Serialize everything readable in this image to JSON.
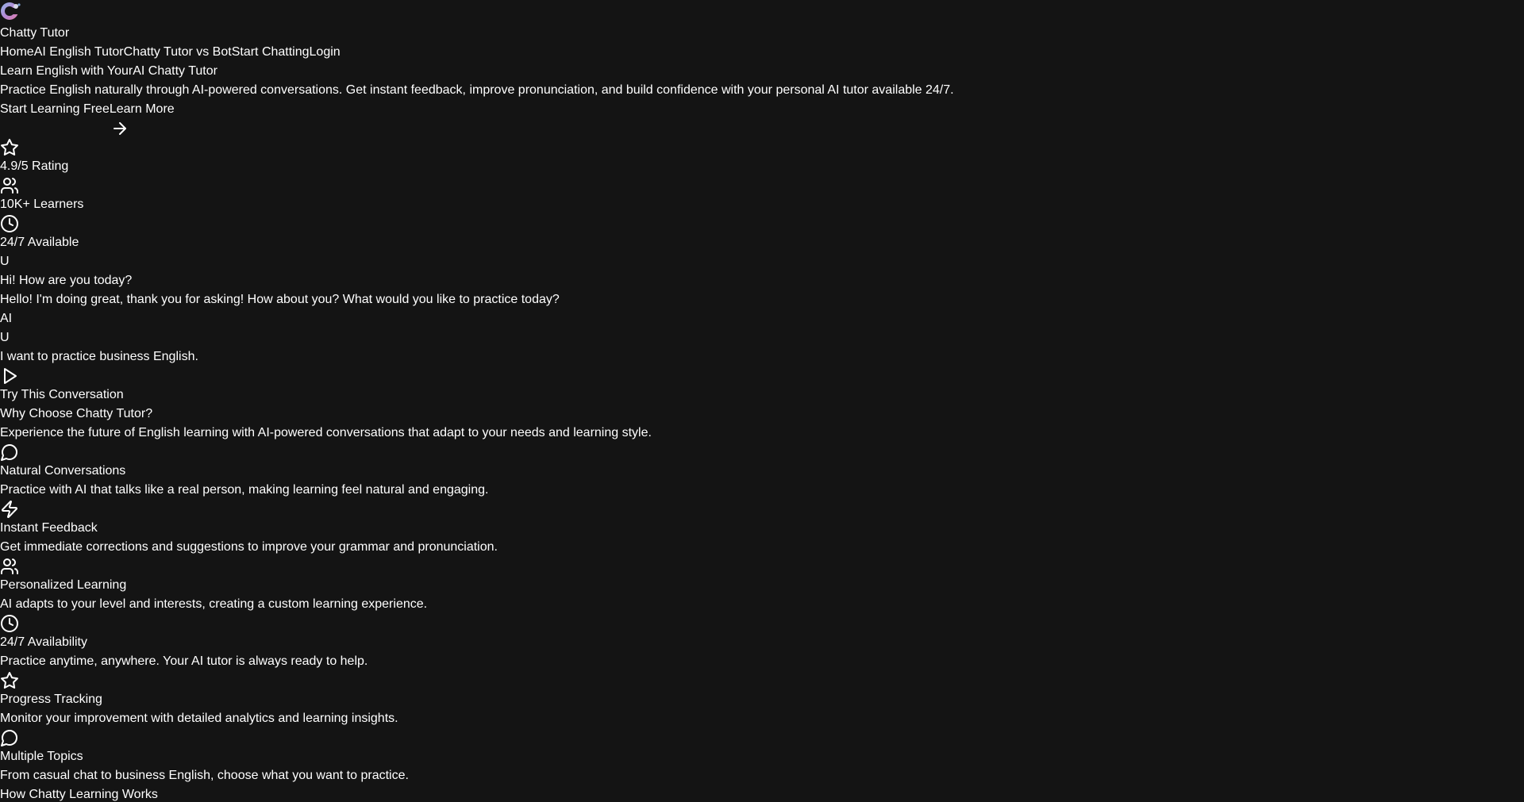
{
  "brand": {
    "name": "Chatty Tutor",
    "logo_icon": "chatty-tutor-logo-icon"
  },
  "nav": {
    "items": [
      "Home",
      "AI English Tutor",
      "Chatty Tutor vs Bot",
      "Start Chatting",
      "Login"
    ]
  },
  "hero": {
    "title_part1": "Learn English with Your",
    "title_part2": "AI Chatty Tutor",
    "description": "Practice English naturally through AI-powered conversations. Get instant feedback, improve pronunciation, and build confidence with your personal AI tutor available 24/7.",
    "primary_cta": "Start Learning Free",
    "secondary_cta": "Learn More"
  },
  "stats": [
    {
      "icon": "star-icon",
      "label": "4.9/5 Rating"
    },
    {
      "icon": "users-icon",
      "label": "10K+ Learners"
    },
    {
      "icon": "clock-icon",
      "label": "24/7 Available"
    }
  ],
  "demo_chat": {
    "user_avatar_1": "U",
    "user_message_1": "Hi! How are you today?",
    "ai_message_1": "Hello! I'm doing great, thank you for asking! How about you? What would you like to practice today?",
    "ai_avatar": "AI",
    "user_avatar_2": "U",
    "user_message_2": "I want to practice business English.",
    "try_button": "Try This Conversation"
  },
  "features": {
    "title": "Why Choose Chatty Tutor?",
    "subtitle": "Experience the future of English learning with AI-powered conversations that adapt to your needs and learning style.",
    "items": [
      {
        "icon": "message-circle-icon",
        "title": "Natural Conversations",
        "description": "Practice with AI that talks like a real person, making learning feel natural and engaging."
      },
      {
        "icon": "zap-icon",
        "title": "Instant Feedback",
        "description": "Get immediate corrections and suggestions to improve your grammar and pronunciation."
      },
      {
        "icon": "users-icon",
        "title": "Personalized Learning",
        "description": "AI adapts to your level and interests, creating a custom learning experience."
      },
      {
        "icon": "clock-icon",
        "title": "24/7 Availability",
        "description": "Practice anytime, anywhere. Your AI tutor is always ready to help."
      },
      {
        "icon": "star-icon",
        "title": "Progress Tracking",
        "description": "Monitor your improvement with detailed analytics and learning insights."
      },
      {
        "icon": "message-circle-icon",
        "title": "Multiple Topics",
        "description": "From casual chat to business English, choose what you want to practice."
      }
    ]
  },
  "how_it_works": {
    "title": "How Chatty Learning Works"
  },
  "colors": {
    "background": "#141414",
    "text": "#ffffff"
  }
}
